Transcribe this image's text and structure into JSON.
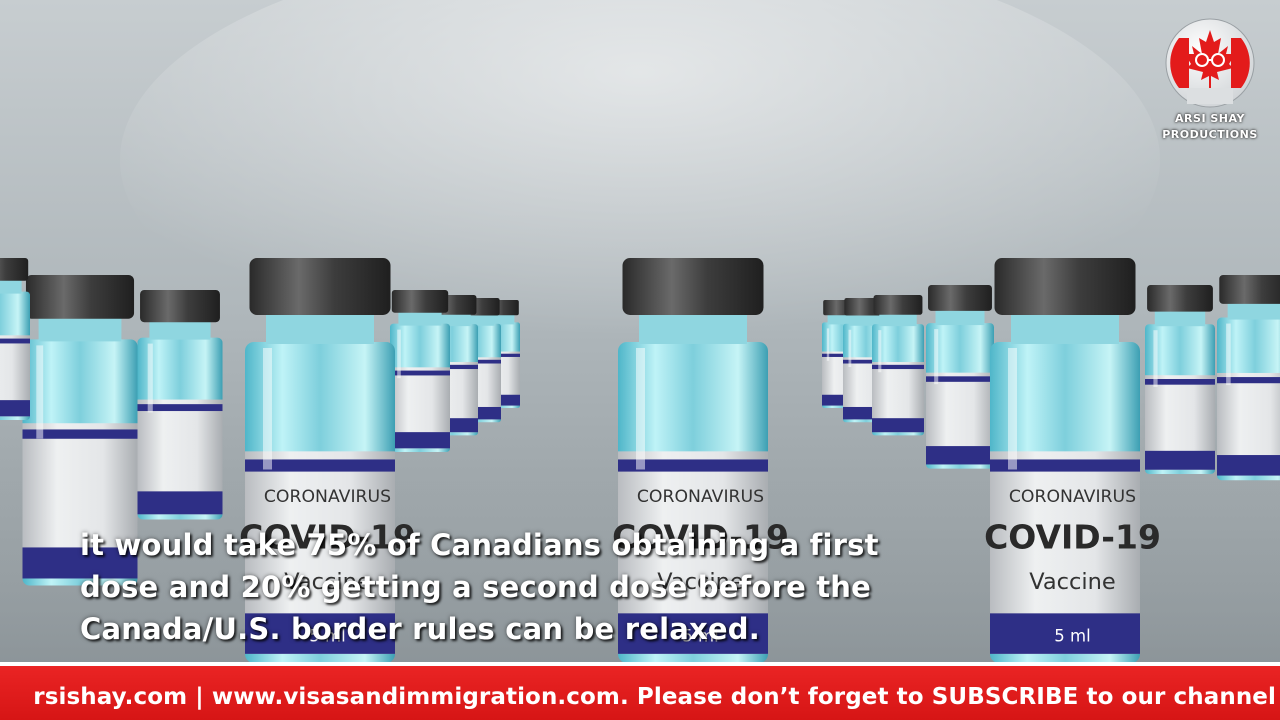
{
  "logo": {
    "line1": "ARSI SHAY",
    "line2": "PRODUCTIONS",
    "colors": {
      "red": "#e31b1b",
      "white": "#ffffff"
    },
    "icon": "maple-leaf-icon"
  },
  "vials": {
    "label_top": "CORONAVIRUS",
    "label_main": "COVID-19",
    "label_sub": "Vaccine",
    "label_volume": "5 ml",
    "label_band_color": "#2e2f86",
    "cap_color": "#3a3a3a"
  },
  "caption": {
    "line1": "it would take 75% of Canadians obtaining a first",
    "line2": "dose and 20% getting a second dose before the",
    "line3": "Canada/U.S. border rules can be relaxed."
  },
  "ticker": {
    "text": "rsishay.com | www.visasandimmigration.com. Please don’t forget to SUBSCRIBE to our channel",
    "background": "#e31b1b"
  }
}
